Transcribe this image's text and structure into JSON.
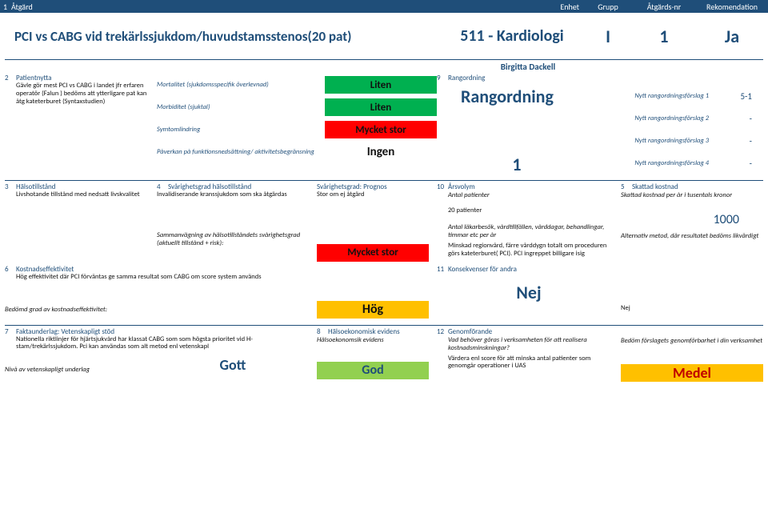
{
  "header": {
    "col1": "1",
    "col2": "Åtgärd",
    "col3": "Enhet",
    "col4": "Grupp",
    "col5": "Åtgärds-nr",
    "col6": "Rekomendation"
  },
  "top": {
    "title": "PCI vs CABG vid trekärlssjukdom/huvudstamsstenos(20 pat)",
    "dept": "511 - Kardiologi",
    "grupp": "I",
    "nr": "1",
    "rek": "Ja",
    "owner": "Birgitta Dackell"
  },
  "s2": {
    "num": "2",
    "lbl": "Patientnytta",
    "text": "Gävle gör mest  PCI vs CABG i landet jfr erfaren operatör (Falun ) bedöms att ytterligare  pat kan åtg  kateterburet (Syntaxstudien)"
  },
  "s9": {
    "num": "9",
    "lbl": "Rangordning",
    "title": "Rangordning",
    "one": "1",
    "rows": [
      {
        "lbl": "Nytt rangordningsförslag 1",
        "val": "5-1"
      },
      {
        "lbl": "Nytt rangordningsförslag 2",
        "val": "-"
      },
      {
        "lbl": "Nytt rangordningsförslag 3",
        "val": "-"
      },
      {
        "lbl": "Nytt rangordningsförslag 4",
        "val": "-"
      }
    ]
  },
  "impact": {
    "rows": [
      {
        "lbl": "Mortalitet (sjukdomsspecifik överlevnad)",
        "val": "Liten",
        "cls": "b-green"
      },
      {
        "lbl": "Morbiditet (sjuktal)",
        "val": "Liten",
        "cls": "b-green"
      },
      {
        "lbl": "Symtomlindring",
        "val": "Mycket stor",
        "cls": "b-red"
      },
      {
        "lbl": "Påverkan på funktionsnedsättning/ aktivitetsbegränsning",
        "val": "Ingen",
        "cls": ""
      }
    ]
  },
  "s3": {
    "num": "3",
    "lbl": "Hälsotillstånd",
    "text": "Livshotande tillstånd med nedsatt livskvalitet"
  },
  "s4": {
    "num": "4",
    "lbl": "Svårighetsgrad hälsotillstånd",
    "text": "Invalidiserande kranssjukdom som ska åtgärdas",
    "agg_lbl": "Sammanvägning av hälsotillståndets svårighetsgrad (aktuellt tillstånd + risk):",
    "agg_val": "Mycket stor"
  },
  "progC": {
    "lbl": "Svårighetsgrad: Prognos",
    "text": "Stor om ej åtgärd"
  },
  "s10": {
    "num": "10",
    "lbl": "Årsvolym",
    "antal": "Antal patienter",
    "pat": "20 patienter",
    "visits": "Antal läkarbesök, vårdtillfällen, vårddagar, behandlingar, timmar etc per år",
    "region": "Minskad regionvård, färre vårddygn totalt om proceduren görs kateterburet( PCI). PCI ingreppet billigare isig"
  },
  "s5": {
    "num": "5",
    "lbl": "Skattad kostnad",
    "sub": "Skattad kostnad per år i tusentals kronor",
    "val": "1000",
    "alt": "Alternativ metod, där resultatet bedöms likvärdigt"
  },
  "s6": {
    "num": "6",
    "lbl": "Kostnadseffektivitet",
    "text": "Hög effektivitet där PCI förväntas ge samma resultat som CABG om score system används",
    "grade_lbl": "Bedömd grad av kostnadseffektivitet:",
    "grade_val": "Hög"
  },
  "s11": {
    "num": "11",
    "lbl": "Konsekvenser för andra",
    "val": "Nej",
    "nej2": "Nej"
  },
  "s7": {
    "num": "7",
    "lbl": "Faktaunderlag: Vetenskapligt stöd",
    "text": "Nationella riktlinjer för hjärtsjukvård har klassat CABG som som högsta prioritet vid H-stam/trekärlssjukdom. Pci kan användas som alt metod enl vetenskapl",
    "level_lbl": "Nivå av vetenskapligt underlag",
    "level_val": "Gott"
  },
  "s8": {
    "num": "8",
    "lbl": "Hälsoekonomisk evidens",
    "sub": "Hälsoekonomsik evidens",
    "val": "God"
  },
  "s12": {
    "num": "12",
    "lbl": "Genomförande",
    "q": "Vad behöver göras i verksamheten för att realisera kostnadsminskningar?",
    "text": "Värdera enl score för att minska antal patienter som genomgår operationer i UAS",
    "judge": "Bedöm förslagets genomförbarhet i din verksamhet",
    "val": "Medel"
  }
}
